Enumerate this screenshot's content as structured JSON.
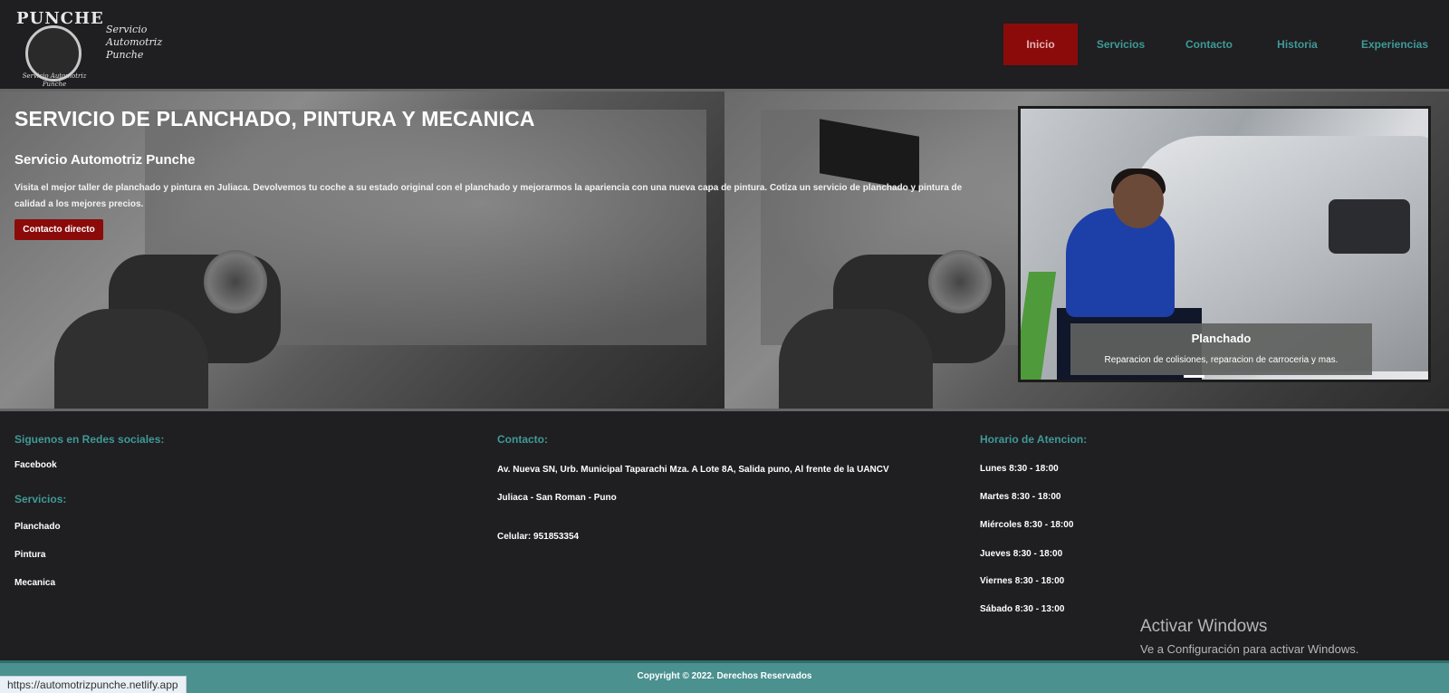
{
  "brand": {
    "logo_word": "PUNCHE",
    "logo_subtitle": "Servicio Automotriz Punche",
    "tagline": [
      "Servicio",
      "Automotriz",
      "Punche"
    ]
  },
  "nav": {
    "items": [
      "Inicio",
      "Servicios",
      "Contacto",
      "Historia",
      "Experiencias"
    ],
    "active_index": 0
  },
  "hero": {
    "title": "SERVICIO DE PLANCHADO, PINTURA Y MECANICA",
    "subtitle": "Servicio Automotriz Punche",
    "description": "Visita el mejor taller de planchado y pintura en Juliaca. Devolvemos tu coche a su estado original con el planchado y mejorarmos la apariencia con una nueva capa de pintura. Cotiza un servicio de planchado y pintura de calidad a los mejores precios.",
    "button_label": "Contacto directo"
  },
  "carousel": {
    "caption_title": "Planchado",
    "caption_text": "Reparacion de colisiones, reparacion de carroceria y mas.",
    "slide_count": 3,
    "active_slide": 0
  },
  "footer": {
    "social": {
      "heading": "Siguenos en Redes sociales:",
      "items": [
        "Facebook"
      ]
    },
    "services": {
      "heading": "Servicios:",
      "items": [
        "Planchado",
        "Pintura",
        "Mecanica"
      ]
    },
    "contact": {
      "heading": "Contacto:",
      "address": "Av. Nueva SN, Urb. Municipal Taparachi Mza. A Lote 8A, Salida puno, Al frente de la UANCV",
      "city": "Juliaca - San Roman - Puno",
      "phone": "Celular: 951853354"
    },
    "hours": {
      "heading": "Horario de Atencion:",
      "items": [
        "Lunes 8:30 - 18:00",
        "Martes 8:30 - 18:00",
        "Miércoles 8:30 - 18:00",
        "Jueves 8:30 - 18:00",
        "Viernes 8:30 - 18:00",
        "Sábado 8:30 - 13:00"
      ]
    },
    "copyright": "Copyright © 2022. Derechos Reservados"
  },
  "windows_watermark": {
    "line1": "Activar Windows",
    "line2": "Ve a Configuración para activar Windows."
  },
  "status_bar": {
    "url": "https://automotrizpunche.netlify.app"
  },
  "colors": {
    "background": "#1f1e21",
    "accent_red": "#8b0b0b",
    "accent_teal": "#3f9a96",
    "copyright_bar": "#4a918f"
  }
}
